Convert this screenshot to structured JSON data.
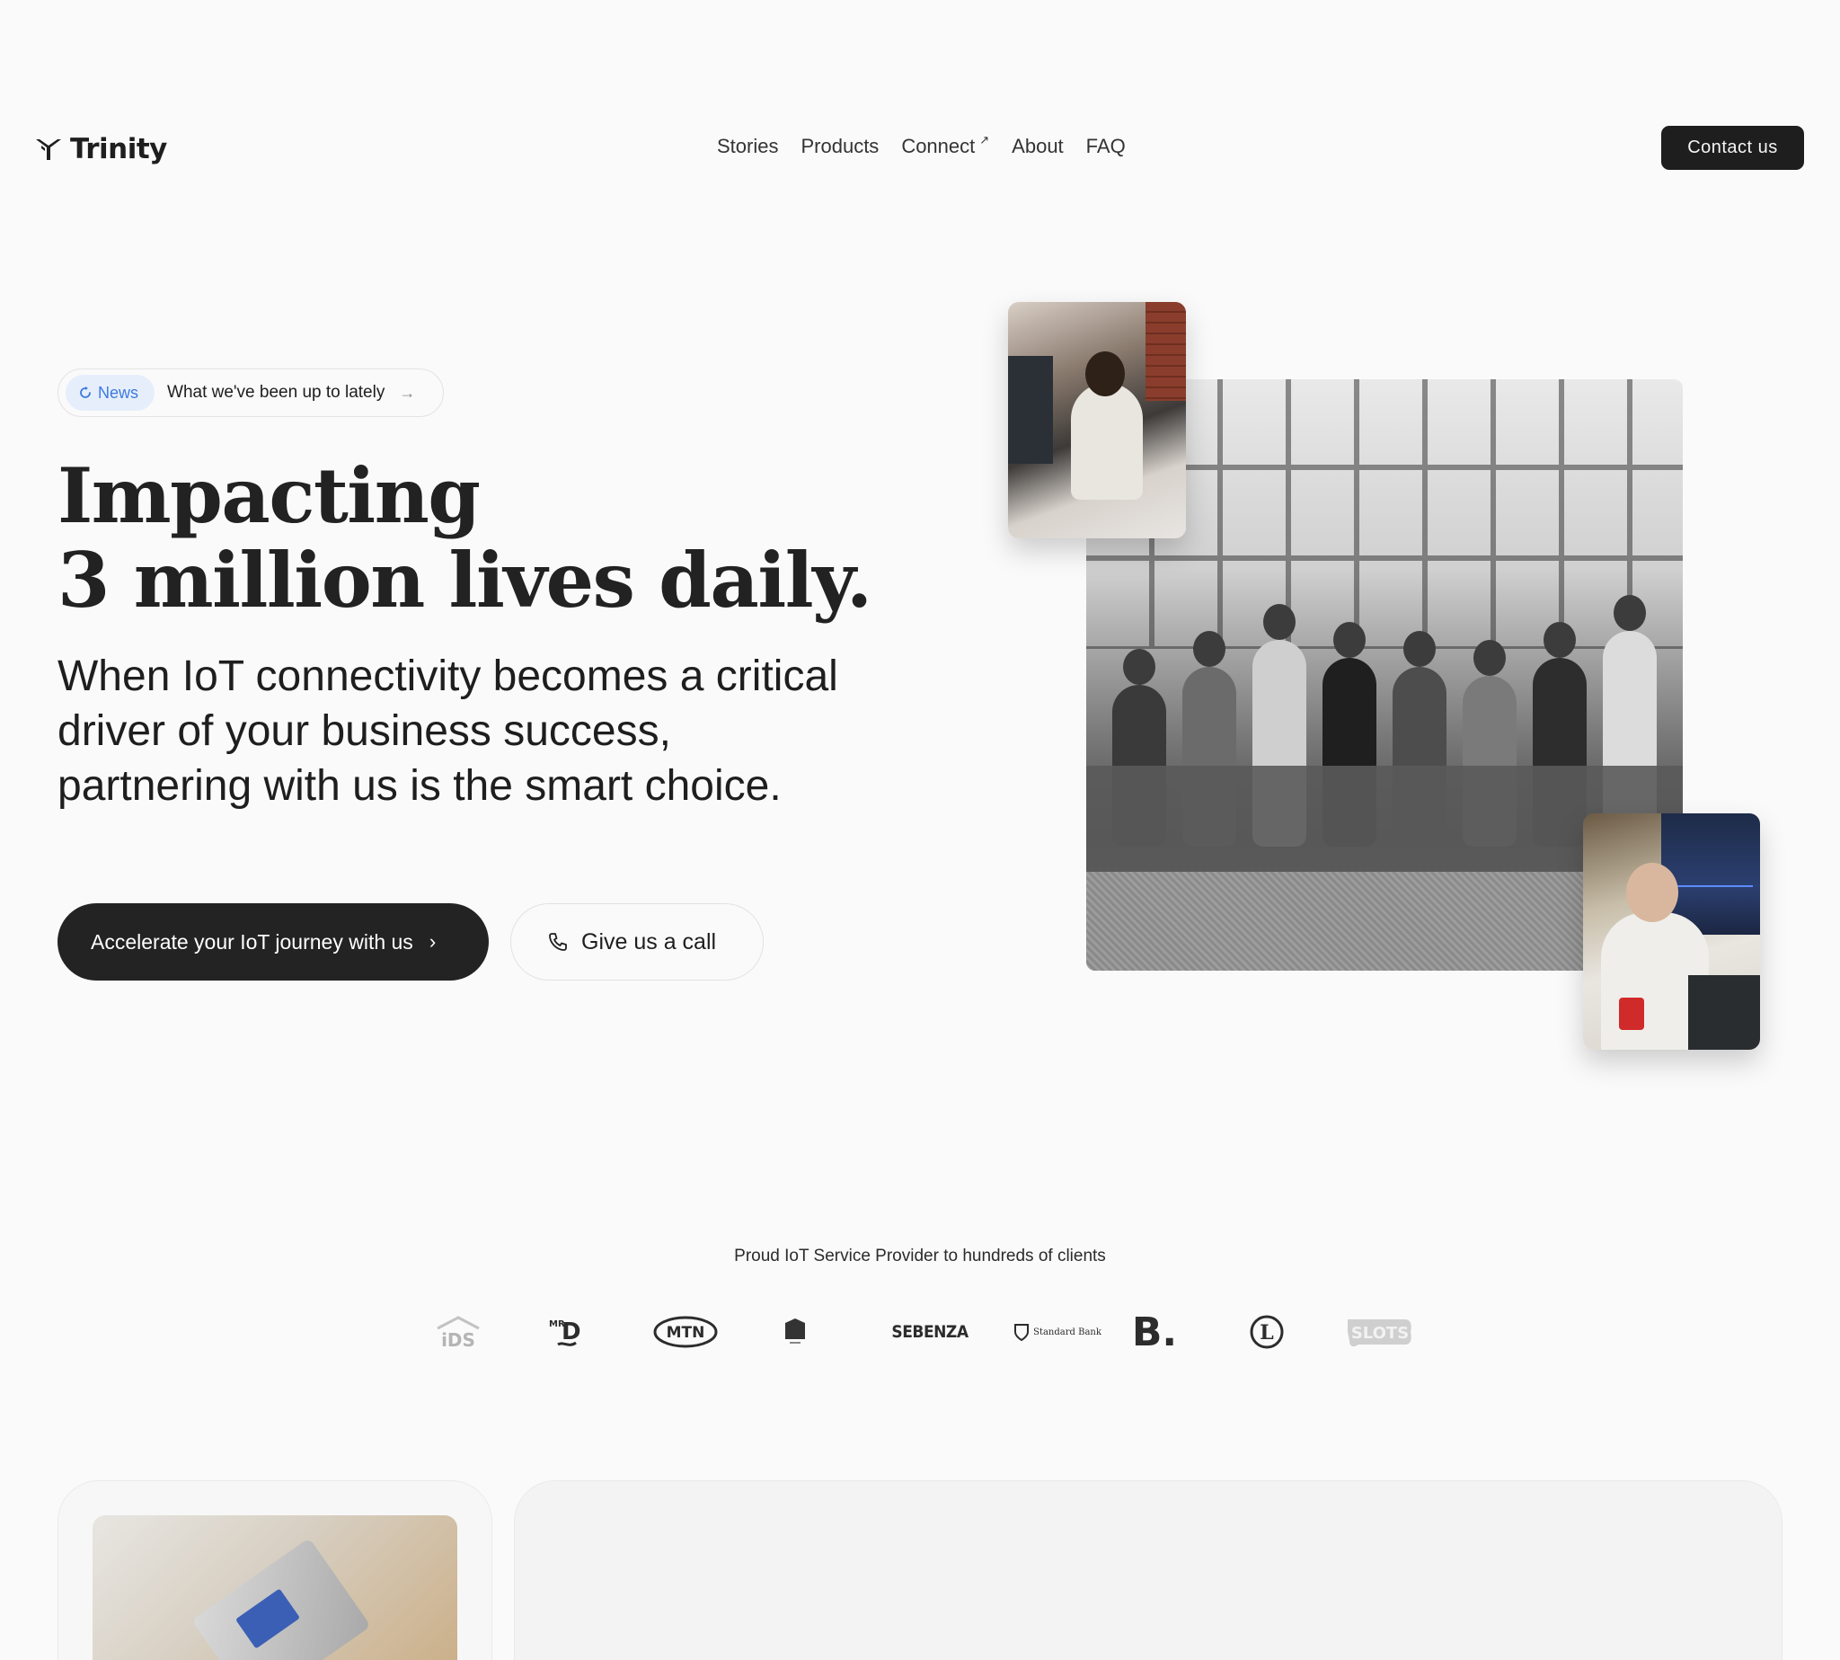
{
  "brand": {
    "name": "Trinity"
  },
  "nav": {
    "items": [
      {
        "label": "Stories"
      },
      {
        "label": "Products"
      },
      {
        "label": "Connect",
        "external_marker": "↗"
      },
      {
        "label": "About"
      },
      {
        "label": "FAQ"
      }
    ],
    "contact_label": "Contact us"
  },
  "news": {
    "tag": "News",
    "text": "What we've been up to lately",
    "arrow": "→"
  },
  "hero": {
    "headline_line1": "Impacting",
    "headline_line2": "3 million lives daily.",
    "sub_line1": "When IoT connectivity becomes a critical",
    "sub_line2": "driver of your business success,",
    "sub_line3": "partnering with us is the smart choice.",
    "cta_primary": "Accelerate your IoT journey with us",
    "cta_primary_chevron": "›",
    "cta_secondary": "Give us a call"
  },
  "clients": {
    "title": "Proud IoT Service Provider to hundreds of clients",
    "logos": [
      {
        "name": "IDS",
        "text": "iDS"
      },
      {
        "name": "Mr D",
        "text": "MR D"
      },
      {
        "name": "MTN",
        "text": "MTN"
      },
      {
        "name": "emblem",
        "text": ""
      },
      {
        "name": "Sebenza",
        "text": "SEBENZA"
      },
      {
        "name": "Standard Bank",
        "text": "Standard Bank"
      },
      {
        "name": "B.",
        "text": "B."
      },
      {
        "name": "L",
        "text": "L"
      },
      {
        "name": "Slots",
        "text": "SLOTS"
      }
    ]
  },
  "colors": {
    "background": "#fafafa",
    "primary_dark": "#1e1e1e",
    "news_accent": "#3d7ae0",
    "news_tag_bg": "#e6eefc"
  }
}
